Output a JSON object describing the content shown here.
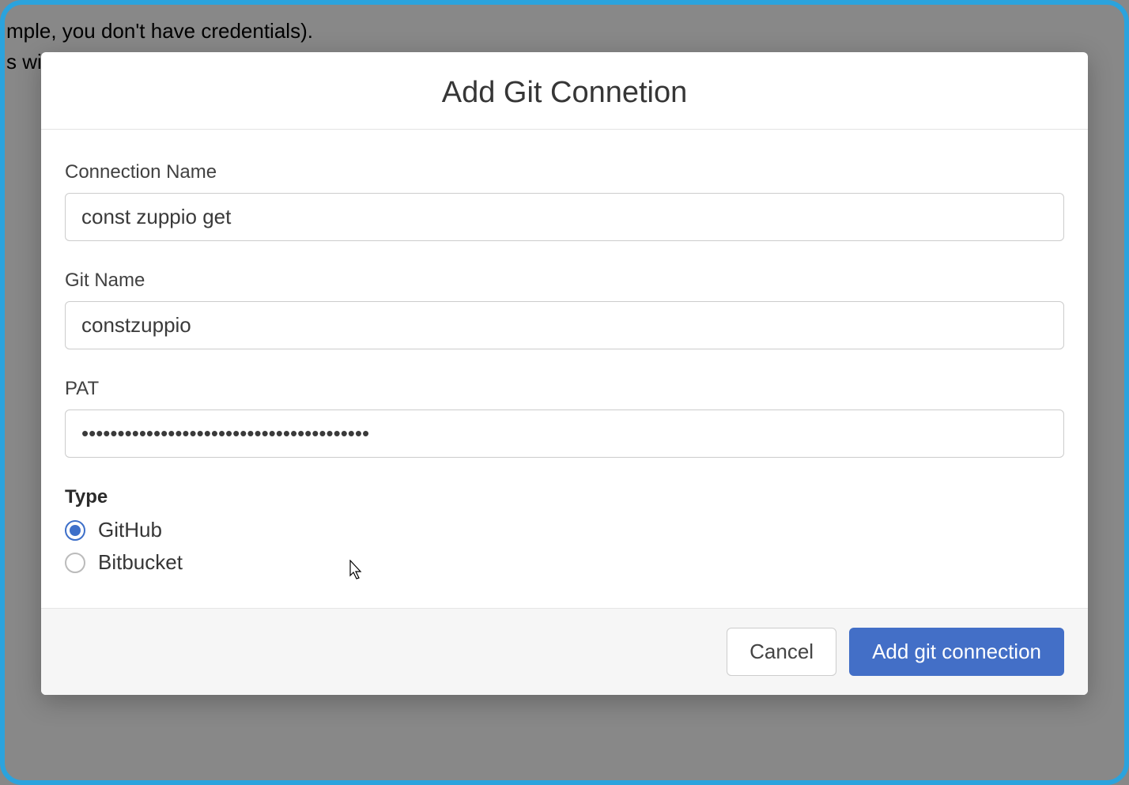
{
  "background": {
    "line1": "mple, you don't have credentials).",
    "line2": "s wi"
  },
  "modal": {
    "title": "Add Git Connetion",
    "fields": {
      "connectionName": {
        "label": "Connection Name",
        "value": "const zuppio get"
      },
      "gitName": {
        "label": "Git Name",
        "value": "constzuppio"
      },
      "pat": {
        "label": "PAT",
        "value": "••••••••••••••••••••••••••••••••••••••••"
      },
      "type": {
        "label": "Type",
        "options": [
          {
            "label": "GitHub",
            "selected": true
          },
          {
            "label": "Bitbucket",
            "selected": false
          }
        ]
      }
    },
    "buttons": {
      "cancel": "Cancel",
      "submit": "Add git connection"
    }
  }
}
